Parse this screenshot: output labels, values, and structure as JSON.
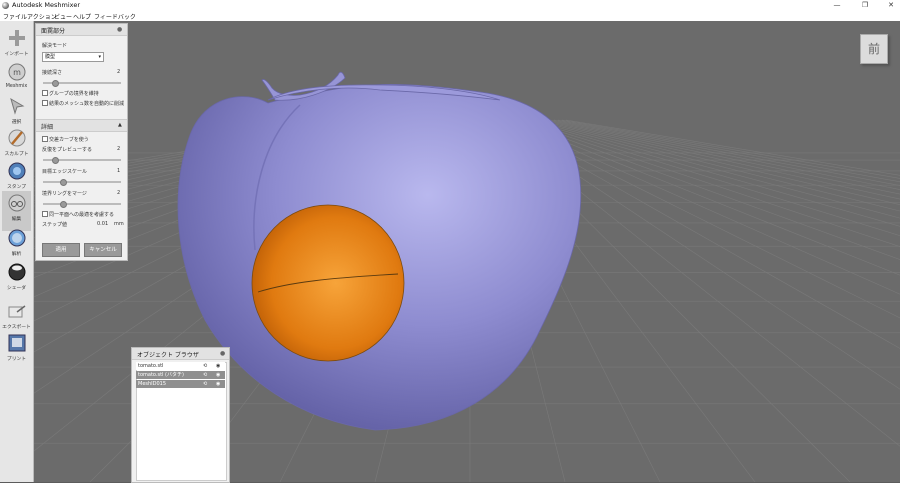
{
  "window": {
    "title": "Autodesk Meshmixer",
    "minimize_glyph": "—",
    "maximize_glyph": "❐",
    "close_glyph": "✕"
  },
  "menu": [
    "ファイル",
    "アクション",
    "ビュー",
    "ヘルプ",
    "フィードバック"
  ],
  "toolbar": [
    {
      "label": "インポート",
      "icon": "plus-icon"
    },
    {
      "label": "Meshmix",
      "icon": "meshmix-sphere-icon"
    },
    {
      "label": "選択",
      "icon": "select-arrow-icon"
    },
    {
      "label": "スカルプト",
      "icon": "sculpt-brush-icon"
    },
    {
      "label": "スタンプ",
      "icon": "stamp-icon"
    },
    {
      "label": "編集",
      "icon": "edit-icon"
    },
    {
      "label": "解析",
      "icon": "analysis-icon"
    },
    {
      "label": "シェーダ",
      "icon": "shader-sphere-icon"
    },
    {
      "label": "エクスポート",
      "icon": "export-icon"
    },
    {
      "label": "プリント",
      "icon": "print-icon"
    }
  ],
  "viewcube": {
    "label": "前"
  },
  "erase_panel": {
    "title": "面罠部分",
    "close_glyph": "●",
    "mode_label": "解決モード",
    "mode_value": "膜型",
    "depth_label": "接続深さ",
    "depth_value": "2",
    "depth_level": 0.15,
    "keep_group_label": "グループの境界を維持",
    "auto_density_label": "結果のメッシュ数を自動的に削減",
    "advanced_title": "詳細",
    "advanced_glyph": "▲",
    "cross_curve_label": "交差カーブを使う",
    "preview_label": "反復をプレビューする",
    "preview_value": "2",
    "preview_level": 0.15,
    "edge_scale_label": "目標エッジスケール",
    "edge_scale_value": "1",
    "edge_scale_level": 0.25,
    "boundary_label": "境界リングをマージ",
    "boundary_value": "2",
    "boundary_level": 0.25,
    "same_plane_label": "同一平面への最適を考慮する",
    "step_label": "ステップ値",
    "step_value": "0.01",
    "step_unit": "mm",
    "apply_label": "適用",
    "cancel_label": "キャンセル"
  },
  "object_browser": {
    "title": "オブジェクト ブラウザ",
    "close_glyph": "●",
    "items": [
      {
        "name": "tomato.stl",
        "selected": false
      },
      {
        "name": "tomato.stl (バタチ)",
        "selected": true
      },
      {
        "name": "MeshID015",
        "selected": true
      }
    ]
  },
  "colors": {
    "mesh": "#8e8cd0",
    "hole_patch": "#e07a10",
    "viewport_bg": "#6b6b6b"
  }
}
